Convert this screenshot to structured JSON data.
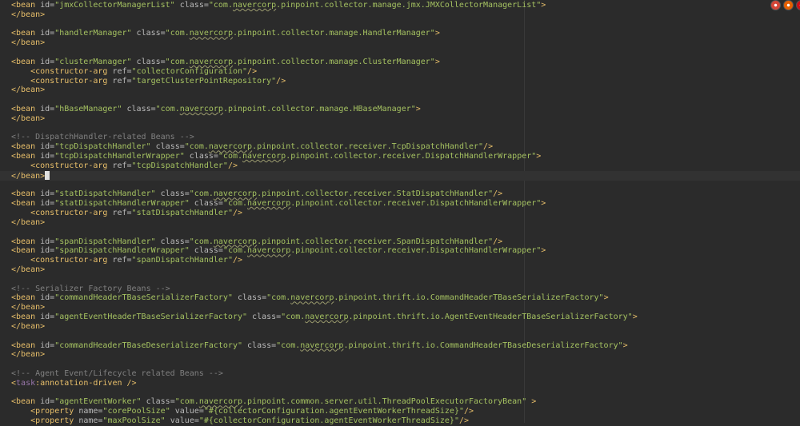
{
  "editor": {
    "caret_line_index": 18,
    "lines": [
      [
        {
          "c": "tag",
          "t": "<bean "
        },
        {
          "c": "attr",
          "t": "id="
        },
        {
          "c": "val",
          "t": "\"jmxCollectorManagerList\""
        },
        {
          "c": "text",
          "t": " "
        },
        {
          "c": "attr",
          "t": "class="
        },
        {
          "c": "val",
          "t": "\"com."
        },
        {
          "c": "val u",
          "t": "navercorp"
        },
        {
          "c": "val",
          "t": ".pinpoint.collector.manage.jmx.JMXCollectorManagerList\""
        },
        {
          "c": "tag",
          "t": ">"
        }
      ],
      [
        {
          "c": "tag",
          "t": "</bean>"
        }
      ],
      [],
      [
        {
          "c": "tag",
          "t": "<bean "
        },
        {
          "c": "attr",
          "t": "id="
        },
        {
          "c": "val",
          "t": "\"handlerManager\""
        },
        {
          "c": "text",
          "t": " "
        },
        {
          "c": "attr",
          "t": "class="
        },
        {
          "c": "val",
          "t": "\"com."
        },
        {
          "c": "val u",
          "t": "navercorp"
        },
        {
          "c": "val",
          "t": ".pinpoint.collector.manage.HandlerManager\""
        },
        {
          "c": "tag",
          "t": ">"
        }
      ],
      [
        {
          "c": "tag",
          "t": "</bean>"
        }
      ],
      [],
      [
        {
          "c": "tag",
          "t": "<bean "
        },
        {
          "c": "attr",
          "t": "id="
        },
        {
          "c": "val",
          "t": "\"clusterManager\""
        },
        {
          "c": "text",
          "t": " "
        },
        {
          "c": "attr",
          "t": "class="
        },
        {
          "c": "val",
          "t": "\"com."
        },
        {
          "c": "val u",
          "t": "navercorp"
        },
        {
          "c": "val",
          "t": ".pinpoint.collector.manage.ClusterManager\""
        },
        {
          "c": "tag",
          "t": ">"
        }
      ],
      [
        {
          "c": "text",
          "t": "    "
        },
        {
          "c": "tag",
          "t": "<constructor-arg "
        },
        {
          "c": "attr",
          "t": "ref="
        },
        {
          "c": "val",
          "t": "\"collectorConfiguration\""
        },
        {
          "c": "tag",
          "t": "/>"
        }
      ],
      [
        {
          "c": "text",
          "t": "    "
        },
        {
          "c": "tag",
          "t": "<constructor-arg "
        },
        {
          "c": "attr",
          "t": "ref="
        },
        {
          "c": "val",
          "t": "\"targetClusterPointRepository\""
        },
        {
          "c": "tag",
          "t": "/>"
        }
      ],
      [
        {
          "c": "tag",
          "t": "</bean>"
        }
      ],
      [],
      [
        {
          "c": "tag",
          "t": "<bean "
        },
        {
          "c": "attr",
          "t": "id="
        },
        {
          "c": "val",
          "t": "\"hBaseManager\""
        },
        {
          "c": "text",
          "t": " "
        },
        {
          "c": "attr",
          "t": "class="
        },
        {
          "c": "val",
          "t": "\"com."
        },
        {
          "c": "val u",
          "t": "navercorp"
        },
        {
          "c": "val",
          "t": ".pinpoint.collector.manage.HBaseManager\""
        },
        {
          "c": "tag",
          "t": ">"
        }
      ],
      [
        {
          "c": "tag",
          "t": "</bean>"
        }
      ],
      [],
      [
        {
          "c": "comment",
          "t": "<!-- DispatchHandler-related Beans -->"
        }
      ],
      [
        {
          "c": "tag",
          "t": "<bean "
        },
        {
          "c": "attr",
          "t": "id="
        },
        {
          "c": "val",
          "t": "\"tcpDispatchHandler\""
        },
        {
          "c": "text",
          "t": " "
        },
        {
          "c": "attr",
          "t": "class="
        },
        {
          "c": "val",
          "t": "\"com."
        },
        {
          "c": "val u",
          "t": "navercorp"
        },
        {
          "c": "val",
          "t": ".pinpoint.collector.receiver.TcpDispatchHandler\""
        },
        {
          "c": "tag",
          "t": "/>"
        }
      ],
      [
        {
          "c": "tag",
          "t": "<bean "
        },
        {
          "c": "attr",
          "t": "id="
        },
        {
          "c": "val",
          "t": "\"tcpDispatchHandlerWrapper\""
        },
        {
          "c": "text",
          "t": " "
        },
        {
          "c": "attr",
          "t": "class="
        },
        {
          "c": "val",
          "t": "\"com."
        },
        {
          "c": "val u",
          "t": "navercorp"
        },
        {
          "c": "val",
          "t": ".pinpoint.collector.receiver.DispatchHandlerWrapper\""
        },
        {
          "c": "tag",
          "t": ">"
        }
      ],
      [
        {
          "c": "text",
          "t": "    "
        },
        {
          "c": "tag",
          "t": "<constructor-arg "
        },
        {
          "c": "attr",
          "t": "ref="
        },
        {
          "c": "val",
          "t": "\"tcpDispatchHandler\""
        },
        {
          "c": "tag",
          "t": "/>"
        }
      ],
      [
        {
          "c": "tag",
          "t": "</bean>"
        },
        {
          "c": "cursor",
          "t": ""
        }
      ],
      [],
      [
        {
          "c": "tag",
          "t": "<bean "
        },
        {
          "c": "attr",
          "t": "id="
        },
        {
          "c": "val",
          "t": "\"statDispatchHandler\""
        },
        {
          "c": "text",
          "t": " "
        },
        {
          "c": "attr",
          "t": "class="
        },
        {
          "c": "val",
          "t": "\"com."
        },
        {
          "c": "val u",
          "t": "navercorp"
        },
        {
          "c": "val",
          "t": ".pinpoint.collector.receiver.StatDispatchHandler\""
        },
        {
          "c": "tag",
          "t": "/>"
        }
      ],
      [
        {
          "c": "tag",
          "t": "<bean "
        },
        {
          "c": "attr",
          "t": "id="
        },
        {
          "c": "val",
          "t": "\"statDispatchHandlerWrapper\""
        },
        {
          "c": "text",
          "t": " "
        },
        {
          "c": "attr",
          "t": "class="
        },
        {
          "c": "val",
          "t": "\"com."
        },
        {
          "c": "val u",
          "t": "navercorp"
        },
        {
          "c": "val",
          "t": ".pinpoint.collector.receiver.DispatchHandlerWrapper\""
        },
        {
          "c": "tag",
          "t": ">"
        }
      ],
      [
        {
          "c": "text",
          "t": "    "
        },
        {
          "c": "tag",
          "t": "<constructor-arg "
        },
        {
          "c": "attr",
          "t": "ref="
        },
        {
          "c": "val",
          "t": "\"statDispatchHandler\""
        },
        {
          "c": "tag",
          "t": "/>"
        }
      ],
      [
        {
          "c": "tag",
          "t": "</bean>"
        }
      ],
      [],
      [
        {
          "c": "tag",
          "t": "<bean "
        },
        {
          "c": "attr",
          "t": "id="
        },
        {
          "c": "val",
          "t": "\"spanDispatchHandler\""
        },
        {
          "c": "text",
          "t": " "
        },
        {
          "c": "attr",
          "t": "class="
        },
        {
          "c": "val",
          "t": "\"com."
        },
        {
          "c": "val u",
          "t": "navercorp"
        },
        {
          "c": "val",
          "t": ".pinpoint.collector.receiver.SpanDispatchHandler\""
        },
        {
          "c": "tag",
          "t": "/>"
        }
      ],
      [
        {
          "c": "tag",
          "t": "<bean "
        },
        {
          "c": "attr",
          "t": "id="
        },
        {
          "c": "val",
          "t": "\"spanDispatchHandlerWrapper\""
        },
        {
          "c": "text",
          "t": " "
        },
        {
          "c": "attr",
          "t": "class="
        },
        {
          "c": "val",
          "t": "\"com."
        },
        {
          "c": "val u",
          "t": "navercorp"
        },
        {
          "c": "val",
          "t": ".pinpoint.collector.receiver.DispatchHandlerWrapper\""
        },
        {
          "c": "tag",
          "t": ">"
        }
      ],
      [
        {
          "c": "text",
          "t": "    "
        },
        {
          "c": "tag",
          "t": "<constructor-arg "
        },
        {
          "c": "attr",
          "t": "ref="
        },
        {
          "c": "val",
          "t": "\"spanDispatchHandler\""
        },
        {
          "c": "tag",
          "t": "/>"
        }
      ],
      [
        {
          "c": "tag",
          "t": "</bean>"
        }
      ],
      [],
      [
        {
          "c": "comment",
          "t": "<!-- Serializer Factory Beans -->"
        }
      ],
      [
        {
          "c": "tag",
          "t": "<bean "
        },
        {
          "c": "attr",
          "t": "id="
        },
        {
          "c": "val",
          "t": "\"commandHeaderTBaseSerializerFactory\""
        },
        {
          "c": "text",
          "t": " "
        },
        {
          "c": "attr",
          "t": "class="
        },
        {
          "c": "val",
          "t": "\"com."
        },
        {
          "c": "val u",
          "t": "navercorp"
        },
        {
          "c": "val",
          "t": ".pinpoint.thrift.io.CommandHeaderTBaseSerializerFactory\""
        },
        {
          "c": "tag",
          "t": ">"
        }
      ],
      [
        {
          "c": "tag",
          "t": "</bean>"
        }
      ],
      [
        {
          "c": "tag",
          "t": "<bean "
        },
        {
          "c": "attr",
          "t": "id="
        },
        {
          "c": "val",
          "t": "\"agentEventHeaderTBaseSerializerFactory\""
        },
        {
          "c": "text",
          "t": " "
        },
        {
          "c": "attr",
          "t": "class="
        },
        {
          "c": "val",
          "t": "\"com."
        },
        {
          "c": "val u",
          "t": "navercorp"
        },
        {
          "c": "val",
          "t": ".pinpoint.thrift.io.AgentEventHeaderTBaseSerializerFactory\""
        },
        {
          "c": "tag",
          "t": ">"
        }
      ],
      [
        {
          "c": "tag",
          "t": "</bean>"
        }
      ],
      [],
      [
        {
          "c": "tag",
          "t": "<bean "
        },
        {
          "c": "attr",
          "t": "id="
        },
        {
          "c": "val",
          "t": "\"commandHeaderTBaseDeserializerFactory\""
        },
        {
          "c": "text",
          "t": " "
        },
        {
          "c": "attr",
          "t": "class="
        },
        {
          "c": "val",
          "t": "\"com."
        },
        {
          "c": "val u",
          "t": "navercorp"
        },
        {
          "c": "val",
          "t": ".pinpoint.thrift.io.CommandHeaderTBaseDeserializerFactory\""
        },
        {
          "c": "tag",
          "t": ">"
        }
      ],
      [
        {
          "c": "tag",
          "t": "</bean>"
        }
      ],
      [],
      [
        {
          "c": "comment",
          "t": "<!-- Agent Event/Lifecycle related Beans -->"
        }
      ],
      [
        {
          "c": "tag",
          "t": "<"
        },
        {
          "c": "ns",
          "t": "task"
        },
        {
          "c": "tag",
          "t": ":annotation-driven />"
        }
      ],
      [],
      [
        {
          "c": "tag",
          "t": "<bean "
        },
        {
          "c": "attr",
          "t": "id="
        },
        {
          "c": "val",
          "t": "\"agentEventWorker\""
        },
        {
          "c": "text",
          "t": " "
        },
        {
          "c": "attr",
          "t": "class="
        },
        {
          "c": "val",
          "t": "\"com."
        },
        {
          "c": "val u",
          "t": "navercorp"
        },
        {
          "c": "val",
          "t": ".pinpoint.common.server.util.ThreadPoolExecutorFactoryBean\""
        },
        {
          "c": "text",
          "t": " "
        },
        {
          "c": "tag",
          "t": ">"
        }
      ],
      [
        {
          "c": "text",
          "t": "    "
        },
        {
          "c": "tag",
          "t": "<property "
        },
        {
          "c": "attr",
          "t": "name="
        },
        {
          "c": "val",
          "t": "\"corePoolSize\""
        },
        {
          "c": "text",
          "t": " "
        },
        {
          "c": "attr",
          "t": "value="
        },
        {
          "c": "val",
          "t": "\"#{collectorConfiguration.agentEventWorkerThreadSize}\""
        },
        {
          "c": "tag",
          "t": "/>"
        }
      ],
      [
        {
          "c": "text",
          "t": "    "
        },
        {
          "c": "tag",
          "t": "<property "
        },
        {
          "c": "attr",
          "t": "name="
        },
        {
          "c": "val",
          "t": "\"maxPoolSize\""
        },
        {
          "c": "text",
          "t": " "
        },
        {
          "c": "attr",
          "t": "value="
        },
        {
          "c": "val",
          "t": "\"#{collectorConfiguration.agentEventWorkerThreadSize}\""
        },
        {
          "c": "tag",
          "t": "/>"
        }
      ]
    ]
  },
  "browser_icons": [
    {
      "name": "chrome-icon",
      "color": "#d44638"
    },
    {
      "name": "firefox-icon",
      "color": "#e66000"
    },
    {
      "name": "opera-icon",
      "color": "#cc0f16"
    }
  ]
}
